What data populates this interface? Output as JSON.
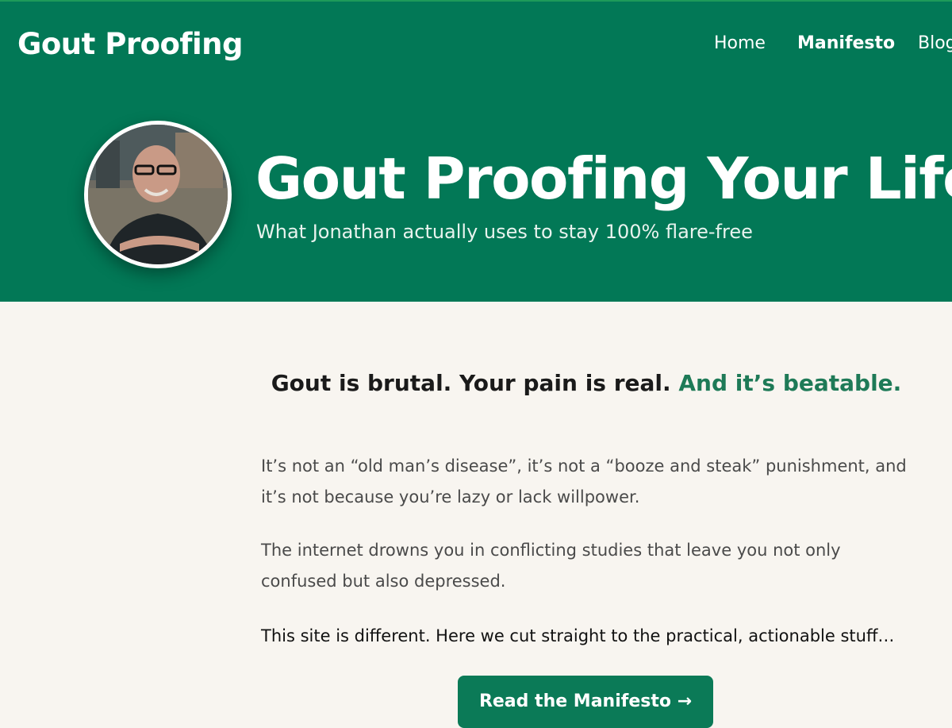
{
  "brand": {
    "name": "Gout Proofing"
  },
  "nav": {
    "items": [
      {
        "label": "Home",
        "active": false
      },
      {
        "label": "Manifesto",
        "active": true
      },
      {
        "label": "Blog",
        "active": false
      }
    ]
  },
  "hero": {
    "title": "Gout Proofing Your Life",
    "subtitle": "What Jonathan actually uses to stay 100% flare-free",
    "avatar_icon": "profile-photo"
  },
  "main": {
    "headline_dark": "Gout is brutal. Your pain is real.",
    "headline_accent": "And it’s beatable.",
    "paragraphs": [
      "It’s not an “old man’s disease”, it’s not a “booze and steak” punishment, and it’s not because you’re lazy or lack willpower.",
      "The internet drowns you in conflicting studies that leave you not only confused but also depressed.",
      "This site is different. Here we cut straight to the practical, actionable stuff…"
    ],
    "cta_label": "Read the Manifesto →"
  },
  "colors": {
    "hero_bg": "#027856",
    "page_bg": "#f8f5f0",
    "accent": "#1e7a57",
    "button_bg": "#0b7a57"
  }
}
